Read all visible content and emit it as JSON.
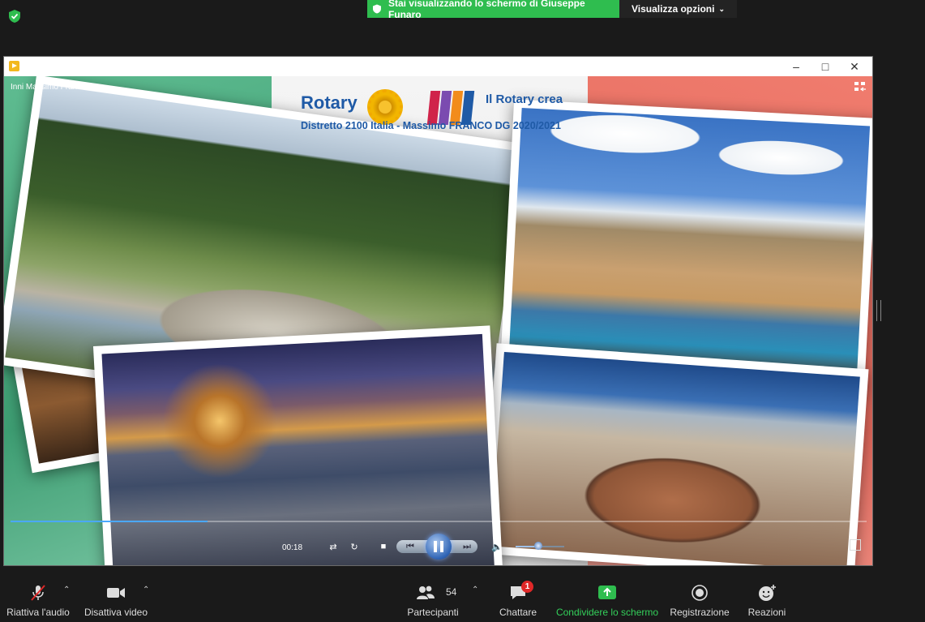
{
  "share_banner": {
    "text": "Stai visualizzando lo schermo di Giuseppe Funaro"
  },
  "view_options": {
    "label": "Visualizza opzioni"
  },
  "player": {
    "video_title": "Inni Massimo Franco",
    "elapsed": "00:18",
    "progress_fraction": 0.23,
    "volume_fraction": 0.45
  },
  "logo": {
    "brand": "Rotary",
    "district": "Distretto 2100  Italia  -  Massimo FRANCO DG 2020/2021",
    "slogan": "Il Rotary crea",
    "bar_colors": [
      "#d0234a",
      "#7b4bb0",
      "#f28c1c",
      "#1f5aa6"
    ]
  },
  "toolbar": {
    "audio": {
      "label": "Riattiva l'audio"
    },
    "video": {
      "label": "Disattiva video"
    },
    "participants": {
      "label": "Partecipanti",
      "count": "54"
    },
    "chat": {
      "label": "Chattare",
      "badge": "1"
    },
    "share": {
      "label": "Condividere lo schermo"
    },
    "record": {
      "label": "Registrazione"
    },
    "reactions": {
      "label": "Reazioni"
    }
  },
  "colors": {
    "accent_green": "#2fbd4f",
    "share_label_green": "#33d05a",
    "mute_red": "#e02828"
  }
}
